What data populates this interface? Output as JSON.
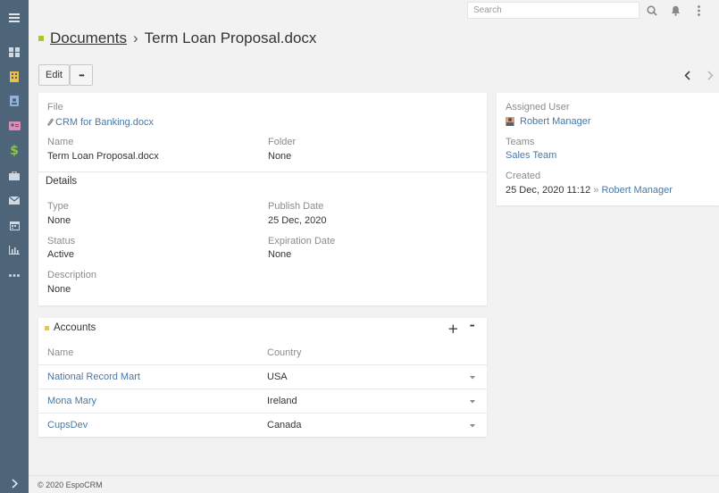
{
  "search": {
    "placeholder": "Search"
  },
  "header": {
    "module": "Documents",
    "separator": "›",
    "record": "Term Loan Proposal.docx"
  },
  "toolbar": {
    "edit_label": "Edit",
    "more_label": "•••"
  },
  "sidebar": {
    "items": [
      {
        "name": "menu-icon"
      },
      {
        "name": "dashboard-icon"
      },
      {
        "name": "accounts-icon"
      },
      {
        "name": "contacts-icon"
      },
      {
        "name": "leads-icon"
      },
      {
        "name": "opportunities-icon"
      },
      {
        "name": "cases-icon"
      },
      {
        "name": "email-icon"
      },
      {
        "name": "calendar-icon"
      },
      {
        "name": "reports-icon"
      },
      {
        "name": "more-icon"
      },
      {
        "name": "collapse-icon"
      }
    ],
    "colors": {
      "background": "#4e6579",
      "accounts": "#e8c14c",
      "contacts": "#8fb3d9",
      "leads": "#d98fb7",
      "opportunities": "#8bc34a"
    }
  },
  "overview": {
    "file_label": "File",
    "file_value": "CRM for Banking.docx",
    "name_label": "Name",
    "name_value": "Term Loan Proposal.docx",
    "folder_label": "Folder",
    "folder_value": "None"
  },
  "details": {
    "title": "Details",
    "type_label": "Type",
    "type_value": "None",
    "publish_label": "Publish Date",
    "publish_value": "25 Dec, 2020",
    "status_label": "Status",
    "status_value": "Active",
    "expiration_label": "Expiration Date",
    "expiration_value": "None",
    "description_label": "Description",
    "description_value": "None"
  },
  "side_panel": {
    "assigned_label": "Assigned User",
    "assigned_value": "Robert Manager",
    "teams_label": "Teams",
    "teams_value": "Sales Team",
    "created_label": "Created",
    "created_date": "25 Dec, 2020 11:12",
    "created_sep": "»",
    "created_by": "Robert Manager"
  },
  "accounts": {
    "title": "Accounts",
    "add_label": "+",
    "more_label": "•••",
    "columns": {
      "name": "Name",
      "country": "Country"
    },
    "rows": [
      {
        "name": "National Record Mart",
        "country": "USA"
      },
      {
        "name": "Mona Mary",
        "country": "Ireland"
      },
      {
        "name": "CupsDev",
        "country": "Canada"
      }
    ]
  },
  "footer": {
    "text": "© 2020 EspoCRM"
  }
}
